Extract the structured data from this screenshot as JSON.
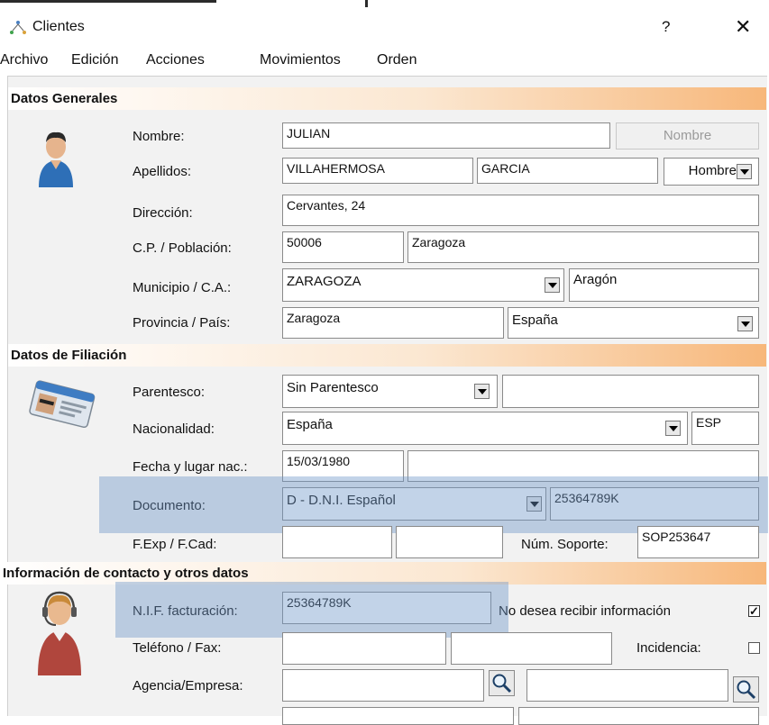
{
  "window": {
    "title": "Clientes",
    "help": "?",
    "close": "✕"
  },
  "menu": {
    "items": [
      "Archivo",
      "Edición",
      "Acciones",
      "Movimientos",
      "Orden"
    ]
  },
  "sections": {
    "general": "Datos Generales",
    "filiacion": "Datos de Filiación",
    "contacto": "Información de contacto y otros datos"
  },
  "labels": {
    "nombre": "Nombre:",
    "apellidos": "Apellidos:",
    "direccion": "Dirección:",
    "cp_poblacion": "C.P. / Población:",
    "municipio_ca": "Municipio / C.A.:",
    "provincia_pais": "Provincia / País:",
    "parentesco": "Parentesco:",
    "nacionalidad": "Nacionalidad:",
    "fecha_lugar": "Fecha y lugar nac.:",
    "documento": "Documento:",
    "fexp_fcad": "F.Exp / F.Cad:",
    "num_soporte": "Núm. Soporte:",
    "nif": "N.I.F. facturación:",
    "no_info": "No desea recibir información",
    "telefono": "Teléfono / Fax:",
    "incidencia": "Incidencia:",
    "agencia": "Agencia/Empresa:"
  },
  "values": {
    "nombre": "JULIAN",
    "nombre_button": "Nombre",
    "apellido1": "VILLAHERMOSA",
    "apellido2": "GARCIA",
    "sexo": "Hombre",
    "direccion": "Cervantes, 24",
    "cp": "50006",
    "poblacion": "Zaragoza",
    "municipio": "ZARAGOZA",
    "ca": "Aragón",
    "provincia": "Zaragoza",
    "pais": "España",
    "parentesco": "Sin Parentesco",
    "parentesco_extra": "",
    "nacionalidad": "España",
    "nacionalidad_code": "ESP",
    "fecha_nac": "15/03/1980",
    "lugar_nac": "",
    "documento_tipo": "D - D.N.I. Español",
    "documento_num": "25364789K",
    "fexp": "",
    "fcad": "",
    "num_soporte": "SOP253647",
    "nif": "25364789K",
    "telefono": "",
    "fax": "",
    "agencia": "",
    "agencia2": ""
  },
  "checks": {
    "no_info": true,
    "incidencia": false
  },
  "icons": {
    "app": "network-icon",
    "general": "person-avatar-icon",
    "filiacion": "id-card-icon",
    "contacto": "headset-agent-icon",
    "search": "magnifier-icon"
  },
  "colors": {
    "section_gradient_end": "#f7b77a",
    "highlight": "#6e96c8"
  }
}
